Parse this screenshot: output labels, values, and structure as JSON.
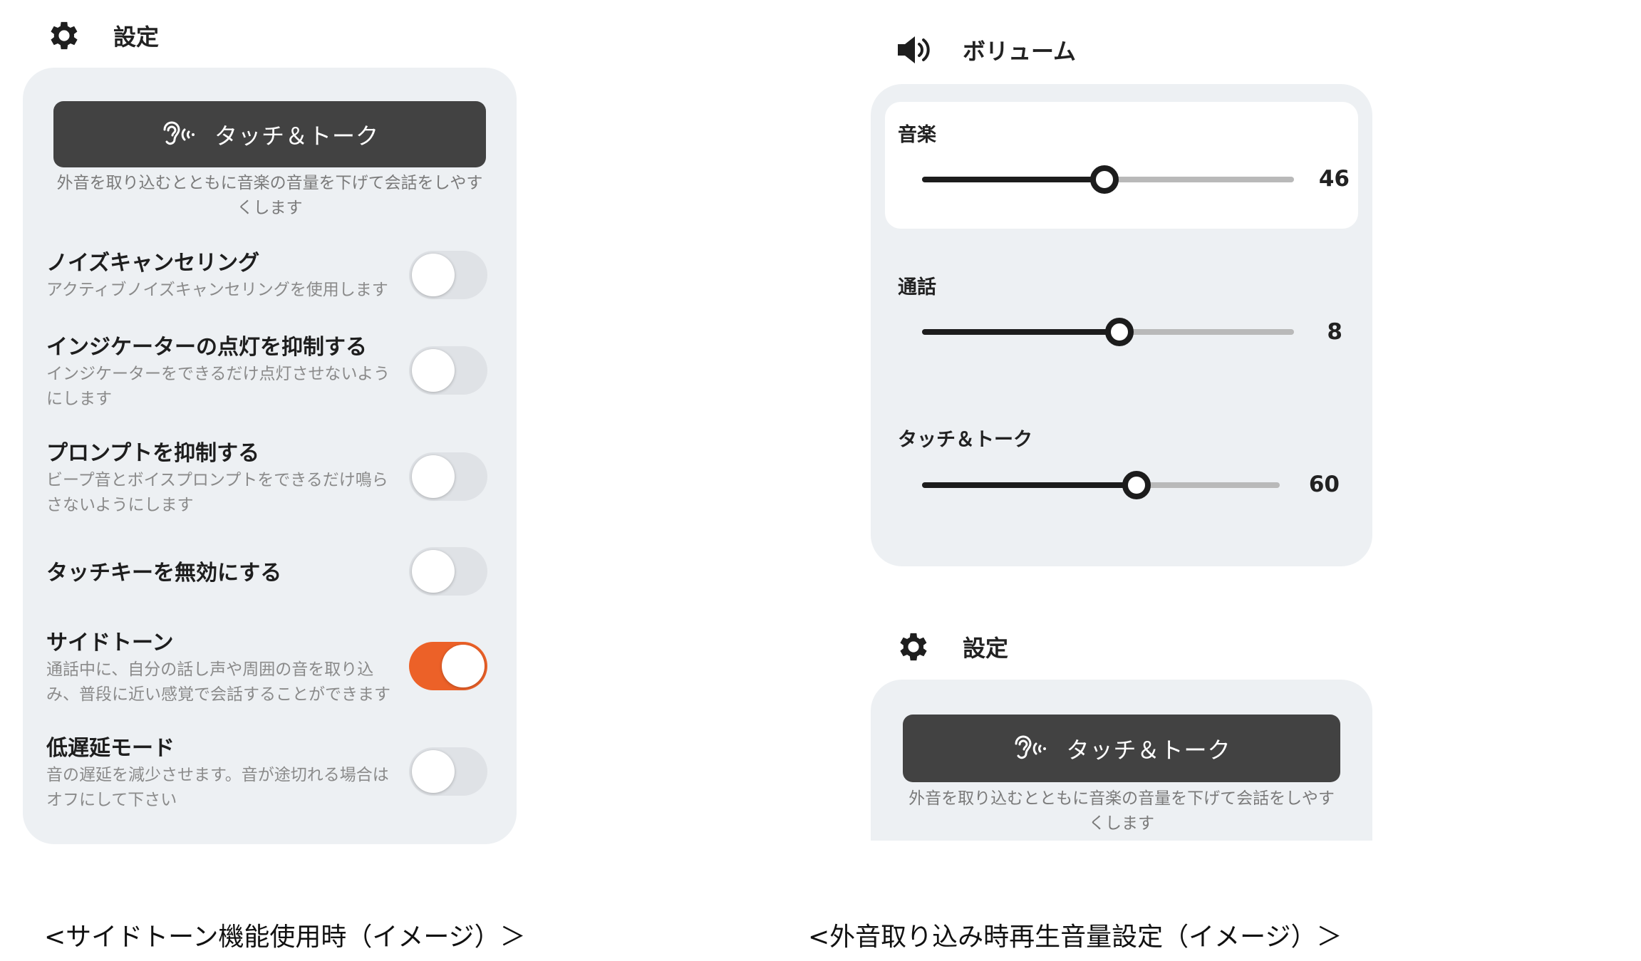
{
  "left": {
    "header": {
      "title": "設定",
      "icon": "gear-icon"
    },
    "touch_talk": {
      "label": "タッチ＆トーク",
      "icon": "ear-icon",
      "desc_line1": "外音を取り込むとともに音楽の音量を下げて会話をしやす",
      "desc_line2": "くします"
    },
    "settings": [
      {
        "title": "ノイズキャンセリング",
        "desc": "アクティブノイズキャンセリングを使用します",
        "on": false
      },
      {
        "title": "インジケーターの点灯を抑制する",
        "desc": "インジケーターをできるだけ点灯させないようにします",
        "on": false
      },
      {
        "title": "プロンプトを抑制する",
        "desc": "ビープ音とボイスプロンプトをできるだけ鳴らさないようにします",
        "on": false
      },
      {
        "title": "タッチキーを無効にする",
        "desc": "",
        "on": false
      },
      {
        "title": "サイドトーン",
        "desc": "通話中に、自分の話し声や周囲の音を取り込み、普段に近い感覚で会話することができます",
        "on": true
      },
      {
        "title": "低遅延モード",
        "desc": "音の遅延を減少させます。音が途切れる場合はオフにして下さい",
        "on": false
      }
    ],
    "caption": "<サイドトーン機能使用時（イメージ）＞"
  },
  "right": {
    "volume_header": {
      "title": "ボリューム",
      "icon": "speaker-icon"
    },
    "volumes": [
      {
        "label": "音楽",
        "value": "46",
        "level": 0.49
      },
      {
        "label": "通話",
        "value": "8",
        "level": 0.53
      },
      {
        "label": "タッチ＆トーク",
        "value": "60",
        "level": 0.6
      }
    ],
    "settings_header": {
      "title": "設定",
      "icon": "gear-icon"
    },
    "touch_talk": {
      "label": "タッチ＆トーク",
      "icon": "ear-icon",
      "desc_line1": "外音を取り込むとともに音楽の音量を下げて会話をしやす",
      "desc_line2": "くします"
    },
    "caption": "<外音取り込み時再生音量設定（イメージ）＞"
  },
  "colors": {
    "accent": "#ec6128",
    "panel": "#edf0f3",
    "button": "#424242"
  }
}
